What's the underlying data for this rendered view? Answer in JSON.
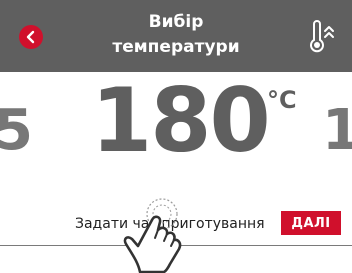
{
  "header": {
    "title_line1": "Вибір",
    "title_line2": "температури",
    "back_icon": "chevron-left-icon",
    "mode_icon": "thermometer-icon"
  },
  "temperature": {
    "value": "180",
    "unit": "°C",
    "previous_value_fragment": "5",
    "next_value_fragment": "1"
  },
  "footer": {
    "cook_time_label": "Задати час приготування",
    "next_label": "ДАЛІ"
  },
  "colors": {
    "header_bg": "#5f5f5f",
    "accent": "#d0102c",
    "value_text": "#5f5f5f"
  }
}
